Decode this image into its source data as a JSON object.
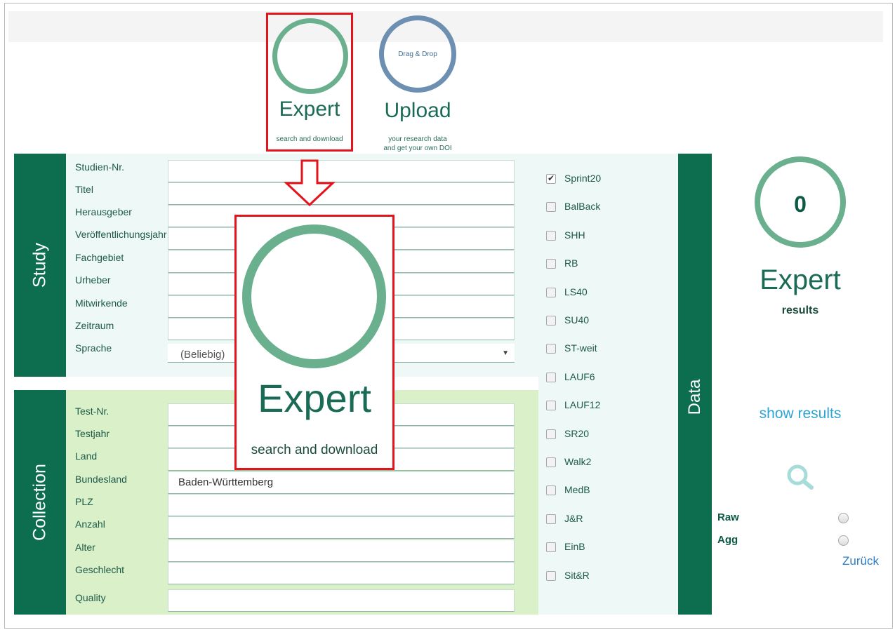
{
  "modes": {
    "expert": {
      "title": "Expert",
      "subtitle": "search and download"
    },
    "upload": {
      "ring_label": "Drag & Drop",
      "title": "Upload",
      "subtitle_line1": "your research data",
      "subtitle_line2": "and get your own DOI"
    }
  },
  "study": {
    "tab_label": "Study",
    "fields": [
      {
        "label": "Studien-Nr.",
        "value": ""
      },
      {
        "label": "Titel",
        "value": ""
      },
      {
        "label": "Herausgeber",
        "value": ""
      },
      {
        "label": "Veröffentlichungsjahr",
        "value": ""
      },
      {
        "label": "Fachgebiet",
        "value": ""
      },
      {
        "label": "Urheber",
        "value": ""
      },
      {
        "label": "Mitwirkende",
        "value": ""
      },
      {
        "label": "Zeitraum",
        "value": ""
      }
    ],
    "language": {
      "label": "Sprache",
      "selected": "(Beliebig)"
    }
  },
  "collection": {
    "tab_label": "Collection",
    "fields": [
      {
        "label": "Test-Nr.",
        "value": ""
      },
      {
        "label": "Testjahr",
        "value": ""
      },
      {
        "label": "Land",
        "value": ""
      },
      {
        "label": "Bundesland",
        "value": "Baden-Württemberg"
      },
      {
        "label": "PLZ",
        "value": ""
      },
      {
        "label": "Anzahl",
        "value": ""
      },
      {
        "label": "Alter",
        "value": ""
      },
      {
        "label": "Geschlecht",
        "value": ""
      },
      {
        "label": "Quality",
        "value": ""
      }
    ]
  },
  "data": {
    "tab_label": "Data",
    "tests": [
      {
        "label": "Sprint20",
        "checked": true
      },
      {
        "label": "BalBack",
        "checked": false
      },
      {
        "label": "SHH",
        "checked": false
      },
      {
        "label": "RB",
        "checked": false
      },
      {
        "label": "LS40",
        "checked": false
      },
      {
        "label": "SU40",
        "checked": false
      },
      {
        "label": "ST-weit",
        "checked": false
      },
      {
        "label": "LAUF6",
        "checked": false
      },
      {
        "label": "LAUF12",
        "checked": false
      },
      {
        "label": "SR20",
        "checked": false
      },
      {
        "label": "Walk2",
        "checked": false
      },
      {
        "label": "MedB",
        "checked": false
      },
      {
        "label": "J&R",
        "checked": false
      },
      {
        "label": "EinB",
        "checked": false
      },
      {
        "label": "Sit&R",
        "checked": false
      }
    ]
  },
  "results": {
    "count": "0",
    "title": "Expert",
    "subtitle": "results",
    "show_results_label": "show results",
    "search_icon": "search-icon",
    "format_options": [
      {
        "label": "Raw",
        "selected": false
      },
      {
        "label": "Agg",
        "selected": false
      }
    ],
    "back_label": "Zurück"
  },
  "zoom": {
    "title": "Expert",
    "subtitle": "search and download"
  },
  "colors": {
    "brand_green": "#0c6e4f",
    "ring_green": "#6ab08e",
    "ring_blue": "#6d8fb1",
    "highlight_red": "#e3141b",
    "link_blue": "#2ea5d7",
    "study_bg": "#eef8f6",
    "collection_bg": "#d9f0c9"
  }
}
